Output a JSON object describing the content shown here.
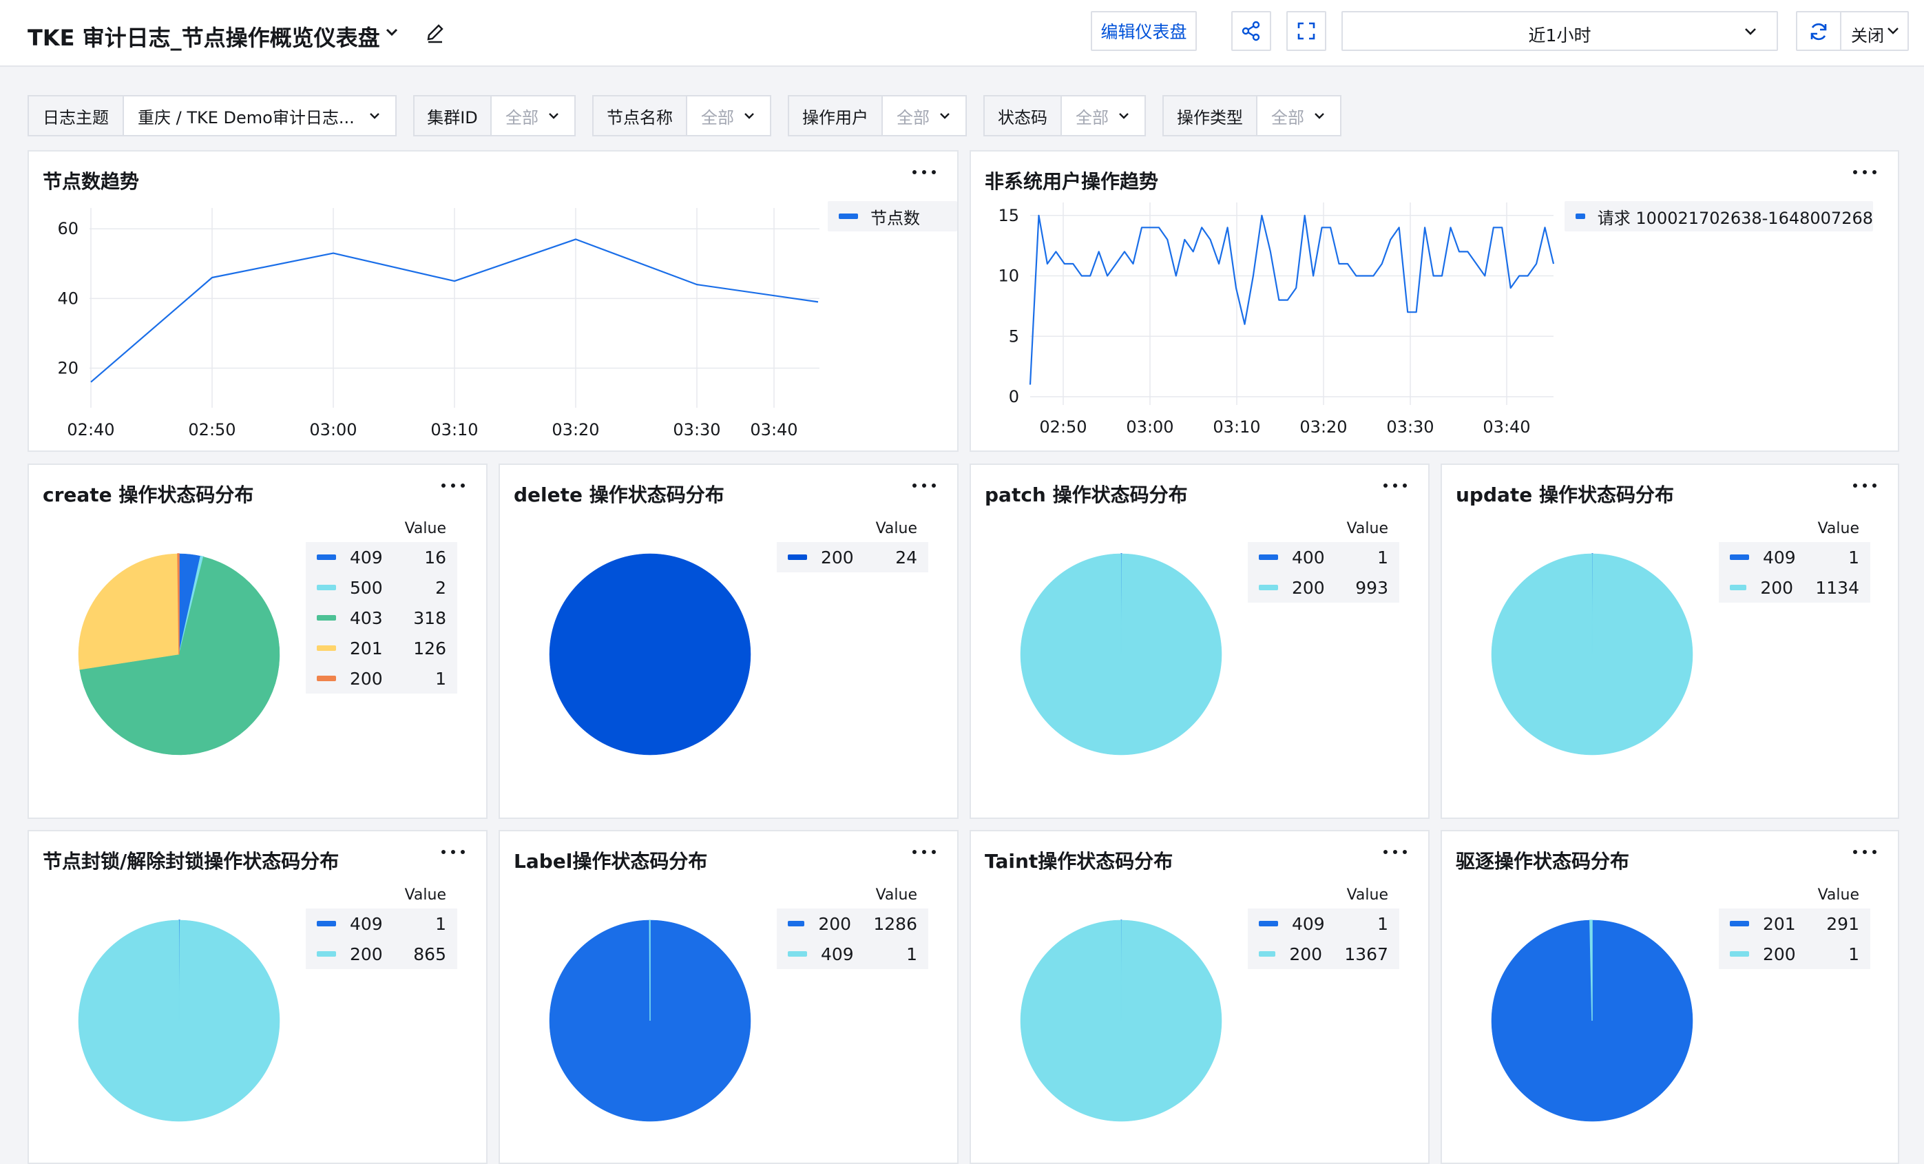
{
  "header": {
    "title": "TKE 审计日志_节点操作概览仪表盘",
    "edit_dashboard_label": "编辑仪表盘",
    "time_range": "近1小时",
    "refresh_label": "关闭"
  },
  "filters": [
    {
      "label": "日志主题",
      "value": "重庆 / TKE Demo审计日志...",
      "placeholder": false
    },
    {
      "label": "集群ID",
      "value": "全部",
      "placeholder": true
    },
    {
      "label": "节点名称",
      "value": "全部",
      "placeholder": true
    },
    {
      "label": "操作用户",
      "value": "全部",
      "placeholder": true
    },
    {
      "label": "状态码",
      "value": "全部",
      "placeholder": true
    },
    {
      "label": "操作类型",
      "value": "全部",
      "placeholder": true
    }
  ],
  "colors": {
    "blue": "#1a6ee8",
    "deep_blue": "#0052d9",
    "cyan": "#7ddfed",
    "green": "#4cc195",
    "yellow": "#ffd46b",
    "orange": "#f0834b",
    "line": "#1a6ee8"
  },
  "panels": {
    "node_trend": {
      "title": "节点数趋势"
    },
    "user_trend": {
      "title": "非系统用户操作趋势"
    },
    "create": {
      "title": "create 操作状态码分布"
    },
    "delete": {
      "title": "delete 操作状态码分布"
    },
    "patch": {
      "title": "patch 操作状态码分布"
    },
    "update": {
      "title": "update 操作状态码分布"
    },
    "cordon": {
      "title": "节点封锁/解除封锁操作状态码分布"
    },
    "label": {
      "title": "Label操作状态码分布"
    },
    "taint": {
      "title": "Taint操作状态码分布"
    },
    "evict": {
      "title": "驱逐操作状态码分布"
    }
  },
  "chart_data": [
    {
      "id": "node_trend",
      "type": "line",
      "title": "节点数趋势",
      "x_ticks": [
        "02:40",
        "02:50",
        "03:00",
        "03:10",
        "03:20",
        "03:30",
        "03:40"
      ],
      "y_ticks": [
        20,
        40,
        60
      ],
      "ylim": [
        11,
        64
      ],
      "series": [
        {
          "name": "节点数",
          "x": [
            "02:40",
            "02:50",
            "03:00",
            "03:10",
            "03:20",
            "03:30",
            "03:40"
          ],
          "values": [
            16,
            46,
            53,
            45,
            57,
            44,
            39
          ]
        }
      ],
      "grid": true,
      "legend": "top-right"
    },
    {
      "id": "user_trend",
      "type": "line",
      "title": "非系统用户操作趋势",
      "x_ticks": [
        "02:50",
        "03:00",
        "03:10",
        "03:20",
        "03:30",
        "03:40"
      ],
      "y_ticks": [
        0,
        5,
        10,
        15
      ],
      "ylim": [
        0,
        15.5
      ],
      "series": [
        {
          "name": "请求 100021702638-1648007268",
          "values": [
            1,
            15,
            11,
            12,
            11,
            11,
            10,
            10,
            12,
            10,
            11,
            12,
            11,
            14,
            14,
            14,
            13,
            10,
            13,
            12,
            14,
            13,
            11,
            14,
            9,
            6,
            10,
            15,
            12,
            8,
            8,
            9,
            15,
            10,
            14,
            14,
            11,
            11,
            10,
            10,
            10,
            11,
            13,
            14,
            7,
            7,
            14,
            10,
            10,
            14,
            12,
            12,
            11,
            10,
            14,
            14,
            9,
            10,
            10,
            11,
            14,
            11
          ]
        }
      ],
      "grid": true,
      "legend": "top-right"
    },
    {
      "id": "create",
      "type": "pie",
      "title": "create 操作状态码分布",
      "legend_header": "Value",
      "slices": [
        {
          "label": "409",
          "value": 16,
          "color": "#1a6ee8"
        },
        {
          "label": "500",
          "value": 2,
          "color": "#7ddfed"
        },
        {
          "label": "403",
          "value": 318,
          "color": "#4cc195"
        },
        {
          "label": "201",
          "value": 126,
          "color": "#ffd46b"
        },
        {
          "label": "200",
          "value": 1,
          "color": "#f0834b"
        }
      ]
    },
    {
      "id": "delete",
      "type": "pie",
      "title": "delete 操作状态码分布",
      "legend_header": "Value",
      "slices": [
        {
          "label": "200",
          "value": 24,
          "color": "#0052d9"
        }
      ]
    },
    {
      "id": "patch",
      "type": "pie",
      "title": "patch 操作状态码分布",
      "legend_header": "Value",
      "slices": [
        {
          "label": "400",
          "value": 1,
          "color": "#1a6ee8"
        },
        {
          "label": "200",
          "value": 993,
          "color": "#7ddfed"
        }
      ]
    },
    {
      "id": "update",
      "type": "pie",
      "title": "update 操作状态码分布",
      "legend_header": "Value",
      "slices": [
        {
          "label": "409",
          "value": 1,
          "color": "#1a6ee8"
        },
        {
          "label": "200",
          "value": 1134,
          "color": "#7ddfed"
        }
      ]
    },
    {
      "id": "cordon",
      "type": "pie",
      "title": "节点封锁/解除封锁操作状态码分布",
      "legend_header": "Value",
      "slices": [
        {
          "label": "409",
          "value": 1,
          "color": "#1a6ee8"
        },
        {
          "label": "200",
          "value": 865,
          "color": "#7ddfed"
        }
      ]
    },
    {
      "id": "label",
      "type": "pie",
      "title": "Label操作状态码分布",
      "legend_header": "Value",
      "slices": [
        {
          "label": "200",
          "value": 1286,
          "color": "#1a6ee8"
        },
        {
          "label": "409",
          "value": 1,
          "color": "#7ddfed"
        }
      ]
    },
    {
      "id": "taint",
      "type": "pie",
      "title": "Taint操作状态码分布",
      "legend_header": "Value",
      "slices": [
        {
          "label": "409",
          "value": 1,
          "color": "#1a6ee8"
        },
        {
          "label": "200",
          "value": 1367,
          "color": "#7ddfed"
        }
      ]
    },
    {
      "id": "evict",
      "type": "pie",
      "title": "驱逐操作状态码分布",
      "legend_header": "Value",
      "slices": [
        {
          "label": "201",
          "value": 291,
          "color": "#1a6ee8"
        },
        {
          "label": "200",
          "value": 1,
          "color": "#7ddfed"
        }
      ]
    }
  ]
}
